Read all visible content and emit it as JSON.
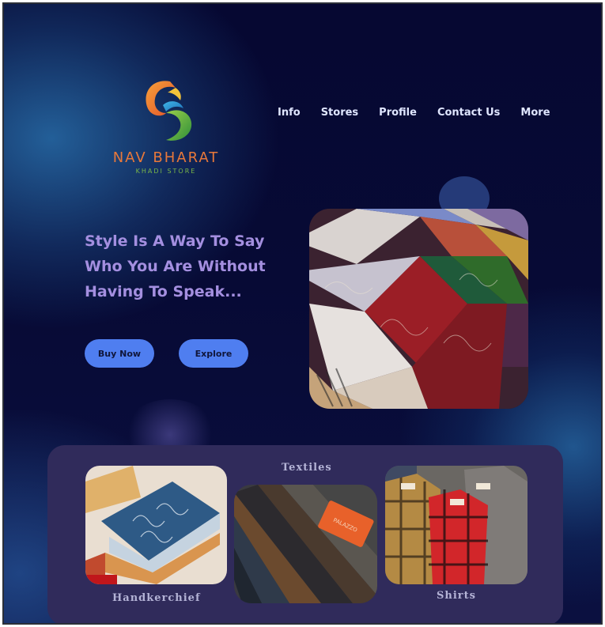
{
  "brand": {
    "name": "NAV BHARAT",
    "tagline": "KHADI STORE",
    "logo_icon": "swirl-logo-icon",
    "colors": {
      "orange": "#e8783a",
      "green": "#7ab648"
    }
  },
  "nav": {
    "items": [
      {
        "label": "Info"
      },
      {
        "label": "Stores"
      },
      {
        "label": "Profile"
      },
      {
        "label": "Contact Us"
      },
      {
        "label": "More"
      }
    ]
  },
  "hero": {
    "lines": [
      "Style Is A Way To Say",
      "Who You  Are Without",
      "Having To Speak..."
    ],
    "buy_label": "Buy Now",
    "explore_label": "Explore",
    "image_subject": "paisley-fabrics-image"
  },
  "categories": {
    "items": [
      {
        "label": "Handkerchief",
        "image": "folded-handkerchiefs-image"
      },
      {
        "label": "Textiles",
        "image": "fabric-rolls-image"
      },
      {
        "label": "Shirts",
        "image": "flannel-shirts-image"
      }
    ]
  },
  "colors": {
    "background": "#060832",
    "accent_button": "#4f7ef0",
    "heading": "#a48fe0",
    "panel": "#302b5b"
  }
}
